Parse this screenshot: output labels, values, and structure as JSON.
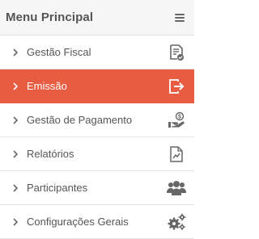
{
  "menu": {
    "title": "Menu Principal",
    "toggle_icon": "hamburger-icon",
    "colors": {
      "active_bg": "#e85c42",
      "text": "#555555",
      "active_text": "#ffffff"
    },
    "items": [
      {
        "label": "Gestão Fiscal",
        "icon": "fiscal-document-icon",
        "active": false
      },
      {
        "label": "Emissão",
        "icon": "export-icon",
        "active": true
      },
      {
        "label": "Gestão de Pagamento",
        "icon": "payment-icon",
        "active": false
      },
      {
        "label": "Relatórios",
        "icon": "report-chart-icon",
        "active": false
      },
      {
        "label": "Participantes",
        "icon": "users-icon",
        "active": false
      },
      {
        "label": "Configurações Gerais",
        "icon": "gears-icon",
        "active": false
      }
    ]
  }
}
